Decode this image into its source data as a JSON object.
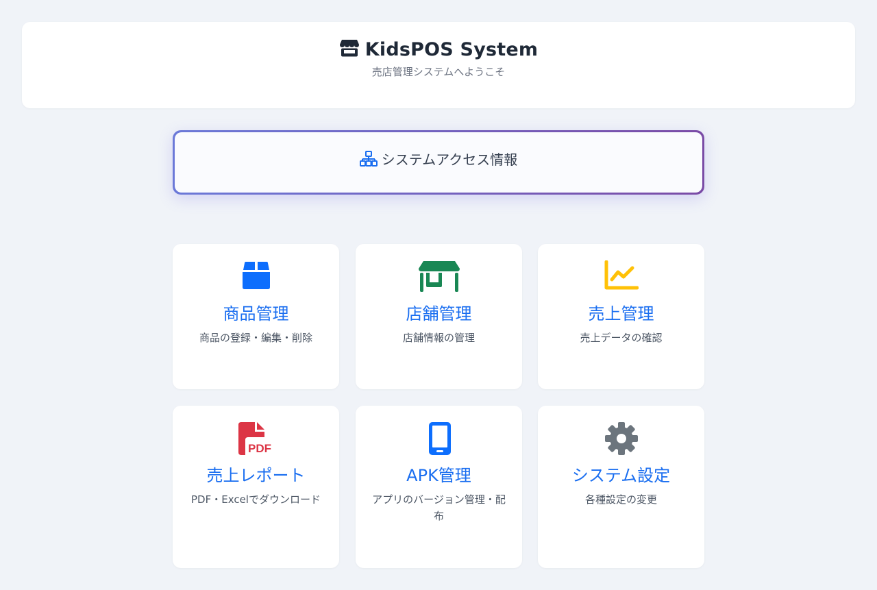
{
  "header": {
    "title": "KidsPOS System",
    "subtitle": "売店管理システムへようこそ",
    "icon": "store-icon"
  },
  "access": {
    "label": "システムアクセス情報",
    "icon": "network-icon"
  },
  "colors": {
    "accent_blue": "#1a6ef0",
    "green": "#198754",
    "yellow": "#ffc107",
    "red": "#dc3545",
    "gray": "#6c757d",
    "gradient_start": "#6b79d8",
    "gradient_end": "#7a4ba6"
  },
  "cards": [
    {
      "title": "商品管理",
      "desc": "商品の登録・編集・削除",
      "icon": "box-icon"
    },
    {
      "title": "店舗管理",
      "desc": "店舗情報の管理",
      "icon": "shop-icon"
    },
    {
      "title": "売上管理",
      "desc": "売上データの確認",
      "icon": "chart-line-icon"
    },
    {
      "title": "売上レポート",
      "desc": "PDF・Excelでダウンロード",
      "icon": "file-pdf-icon"
    },
    {
      "title": "APK管理",
      "desc": "アプリのバージョン管理・配布",
      "icon": "phone-icon"
    },
    {
      "title": "システム設定",
      "desc": "各種設定の変更",
      "icon": "gear-icon"
    }
  ]
}
